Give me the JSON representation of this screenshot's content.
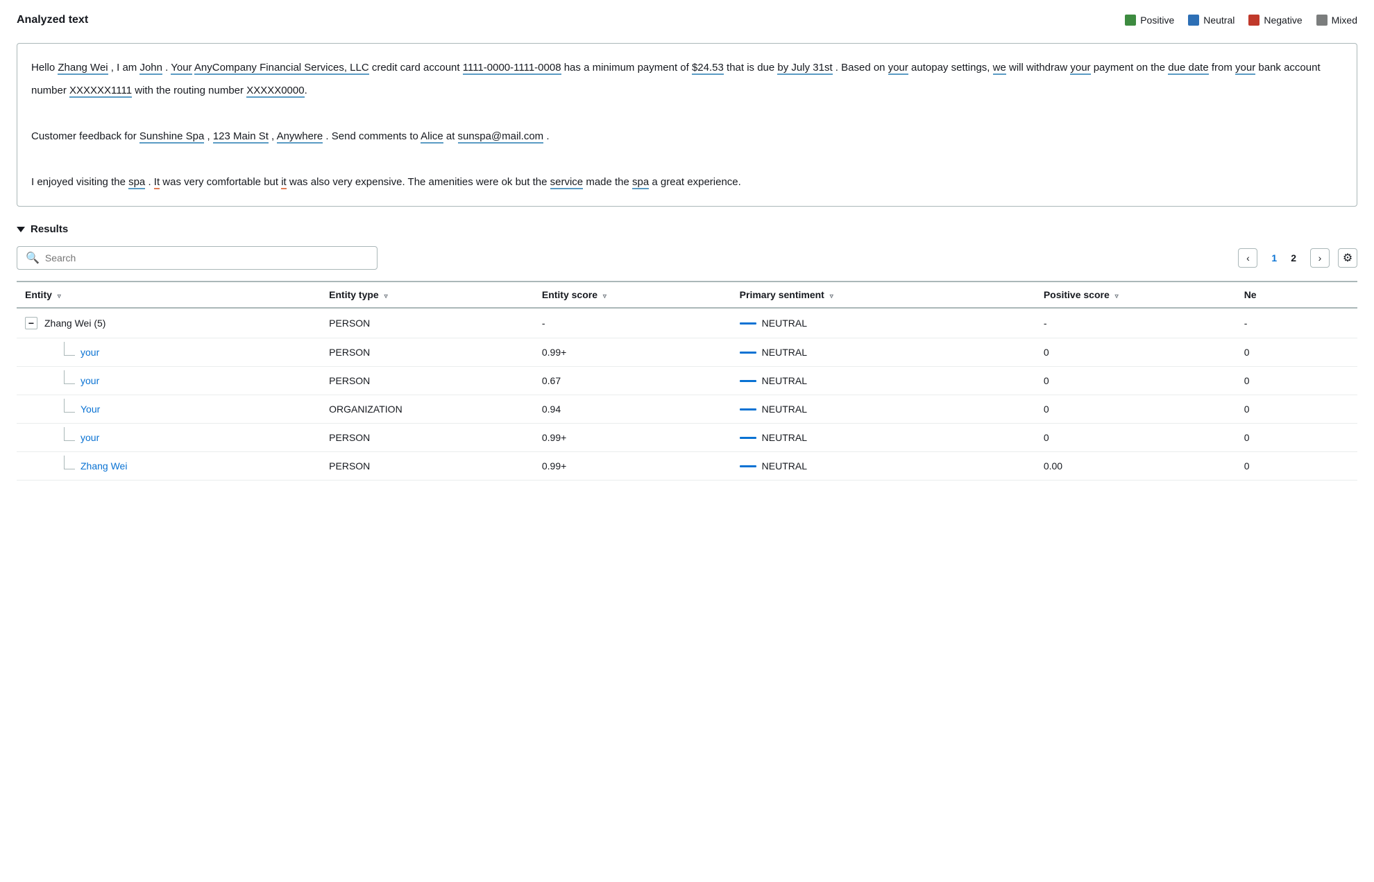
{
  "page": {
    "title": "Analyzed text"
  },
  "legend": {
    "items": [
      {
        "label": "Positive",
        "color": "#3d8b40"
      },
      {
        "label": "Neutral",
        "color": "#2d6fb5"
      },
      {
        "label": "Negative",
        "color": "#c0392b"
      },
      {
        "label": "Mixed",
        "color": "#7b7d7d"
      }
    ]
  },
  "analyzed_text": {
    "paragraphs": [
      "Hello Zhang Wei , I am John . Your AnyCompany Financial Services, LLC credit card account 1111-0000-1111-0008 has a minimum payment of $24.53 that is due by July 31st . Based on your autopay settings, we will withdraw your payment on the due date from your bank account number XXXXXX1111 with the routing number XXXXX0000.",
      "Customer feedback for Sunshine Spa , 123 Main St , Anywhere . Send comments to Alice at sunspa@mail.com .",
      "I enjoyed visiting the spa . It was very comfortable but it was also very expensive. The amenities were ok but the service made the spa a great experience."
    ]
  },
  "results": {
    "section_label": "Results",
    "search_placeholder": "Search",
    "pagination": {
      "current_page": 1,
      "total_pages": 2,
      "prev_label": "<",
      "next_label": ">"
    },
    "table": {
      "headers": [
        {
          "key": "entity",
          "label": "Entity"
        },
        {
          "key": "entity_type",
          "label": "Entity type"
        },
        {
          "key": "entity_score",
          "label": "Entity score"
        },
        {
          "key": "primary_sentiment",
          "label": "Primary sentiment"
        },
        {
          "key": "positive_score",
          "label": "Positive score"
        },
        {
          "key": "neg",
          "label": "Ne"
        }
      ],
      "rows": [
        {
          "id": "zhang-wei-group",
          "type": "parent",
          "entity": "Zhang Wei (5)",
          "entity_type": "PERSON",
          "entity_score": "-",
          "primary_sentiment": "NEUTRAL",
          "positive_score": "-",
          "neg_score": "-",
          "expanded": true
        },
        {
          "id": "your-1",
          "type": "child",
          "entity": "your",
          "entity_type": "PERSON",
          "entity_score": "0.99+",
          "primary_sentiment": "NEUTRAL",
          "positive_score": "0",
          "neg_score": "0"
        },
        {
          "id": "your-2",
          "type": "child",
          "entity": "your",
          "entity_type": "PERSON",
          "entity_score": "0.67",
          "primary_sentiment": "NEUTRAL",
          "positive_score": "0",
          "neg_score": "0"
        },
        {
          "id": "your-3",
          "type": "child",
          "entity": "Your",
          "entity_type": "ORGANIZATION",
          "entity_score": "0.94",
          "primary_sentiment": "NEUTRAL",
          "positive_score": "0",
          "neg_score": "0"
        },
        {
          "id": "your-4",
          "type": "child",
          "entity": "your",
          "entity_type": "PERSON",
          "entity_score": "0.99+",
          "primary_sentiment": "NEUTRAL",
          "positive_score": "0",
          "neg_score": "0"
        },
        {
          "id": "zhang-wei-2",
          "type": "child",
          "entity": "Zhang Wei",
          "entity_type": "PERSON",
          "entity_score": "0.99+",
          "primary_sentiment": "NEUTRAL",
          "positive_score": "0.00",
          "neg_score": "0"
        }
      ]
    }
  }
}
